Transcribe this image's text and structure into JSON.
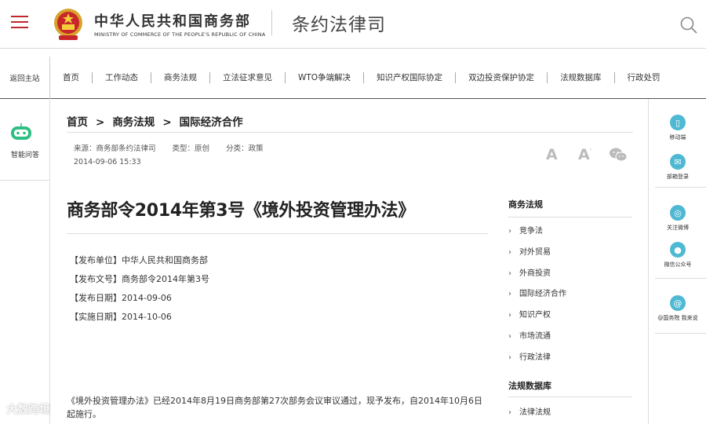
{
  "header": {
    "org_name_cn": "中华人民共和国商务部",
    "org_name_en": "MINISTRY OF COMMERCE OF THE PEOPLE'S REPUBLIC OF CHINA",
    "department": "条约法律司",
    "icons": {
      "menu": "hamburger-menu-icon",
      "emblem": "national-emblem-icon",
      "search": "search-icon"
    }
  },
  "nav": {
    "home_label": "返回主站",
    "items": [
      "首页",
      "工作动态",
      "商务法规",
      "立法征求意见",
      "WTO争端解决",
      "知识产权国际协定",
      "双边投资保护协定",
      "法规数据库",
      "行政处罚"
    ]
  },
  "left_rail": {
    "assistant_label": "智能问答"
  },
  "right_rail": {
    "items": [
      {
        "icon": "mobile-icon",
        "label": "移动端"
      },
      {
        "icon": "mail-icon",
        "label": "部箱登录"
      },
      {
        "icon": "weibo-icon",
        "label": "关注微博"
      },
      {
        "icon": "wechat-icon",
        "label": "微信公众号"
      },
      {
        "icon": "at-icon",
        "label": "@国务院 我来说"
      }
    ]
  },
  "breadcrumb": {
    "home": "首页",
    "sep": ">",
    "level1": "商务法规",
    "level2": "国际经济合作"
  },
  "meta": {
    "source": "来源：商务部条约法律司",
    "type": "类型：原创",
    "category": "分类：政策",
    "datetime": "2014-09-06 15:33"
  },
  "tools": {
    "font_large": "A",
    "font_small": "A",
    "share_icon": "wechat-share-icon"
  },
  "article": {
    "title": "商务部令2014年第3号《境外投资管理办法》",
    "info": [
      "【发布单位】中华人民共和国商务部",
      "【发布文号】商务部令2014年第3号",
      "【发布日期】2014-09-06",
      "【实施日期】2014-10-06"
    ],
    "body": "《境外投资管理办法》已经2014年8月19日商务部第27次部务会议审议通过，现予发布，自2014年10月6日起施行。"
  },
  "sidebar": {
    "section1_title": "商务法规",
    "section1_items": [
      "竞争法",
      "对外贸易",
      "外商投资",
      "国际经济合作",
      "知识产权",
      "市场流通",
      "行政法律"
    ],
    "section2_title": "法规数据库",
    "section2_items": [
      "法律法规"
    ]
  },
  "watermark": "大数跨境"
}
